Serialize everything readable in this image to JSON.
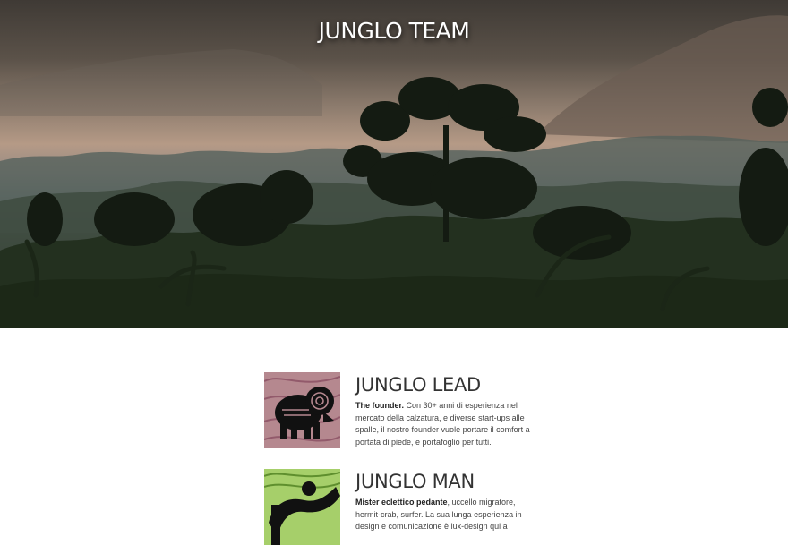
{
  "hero": {
    "title": "JUNGLO TEAM"
  },
  "team": [
    {
      "name": "JUNGLO LEAD",
      "bio_bold": "The founder.",
      "bio_text": " Con 30+ anni di esperienza nel mercato della calzatura, e diverse start-ups alle spalle, il nostro founder vuole portare il comfort a portata di piede, e portafoglio per tutti.",
      "avatar_icon": "ram-pattern-icon",
      "avatar_color": "#b5888f"
    },
    {
      "name": "JUNGLO MAN",
      "bio_bold": "Mister eclettico pedante",
      "bio_text": ", uccello migratore, hermit-crab, surfer. La sua lunga esperienza in design e comunicazione è lux-design qui a",
      "avatar_icon": "dragon-pattern-icon",
      "avatar_color": "#a6cf6a"
    }
  ]
}
